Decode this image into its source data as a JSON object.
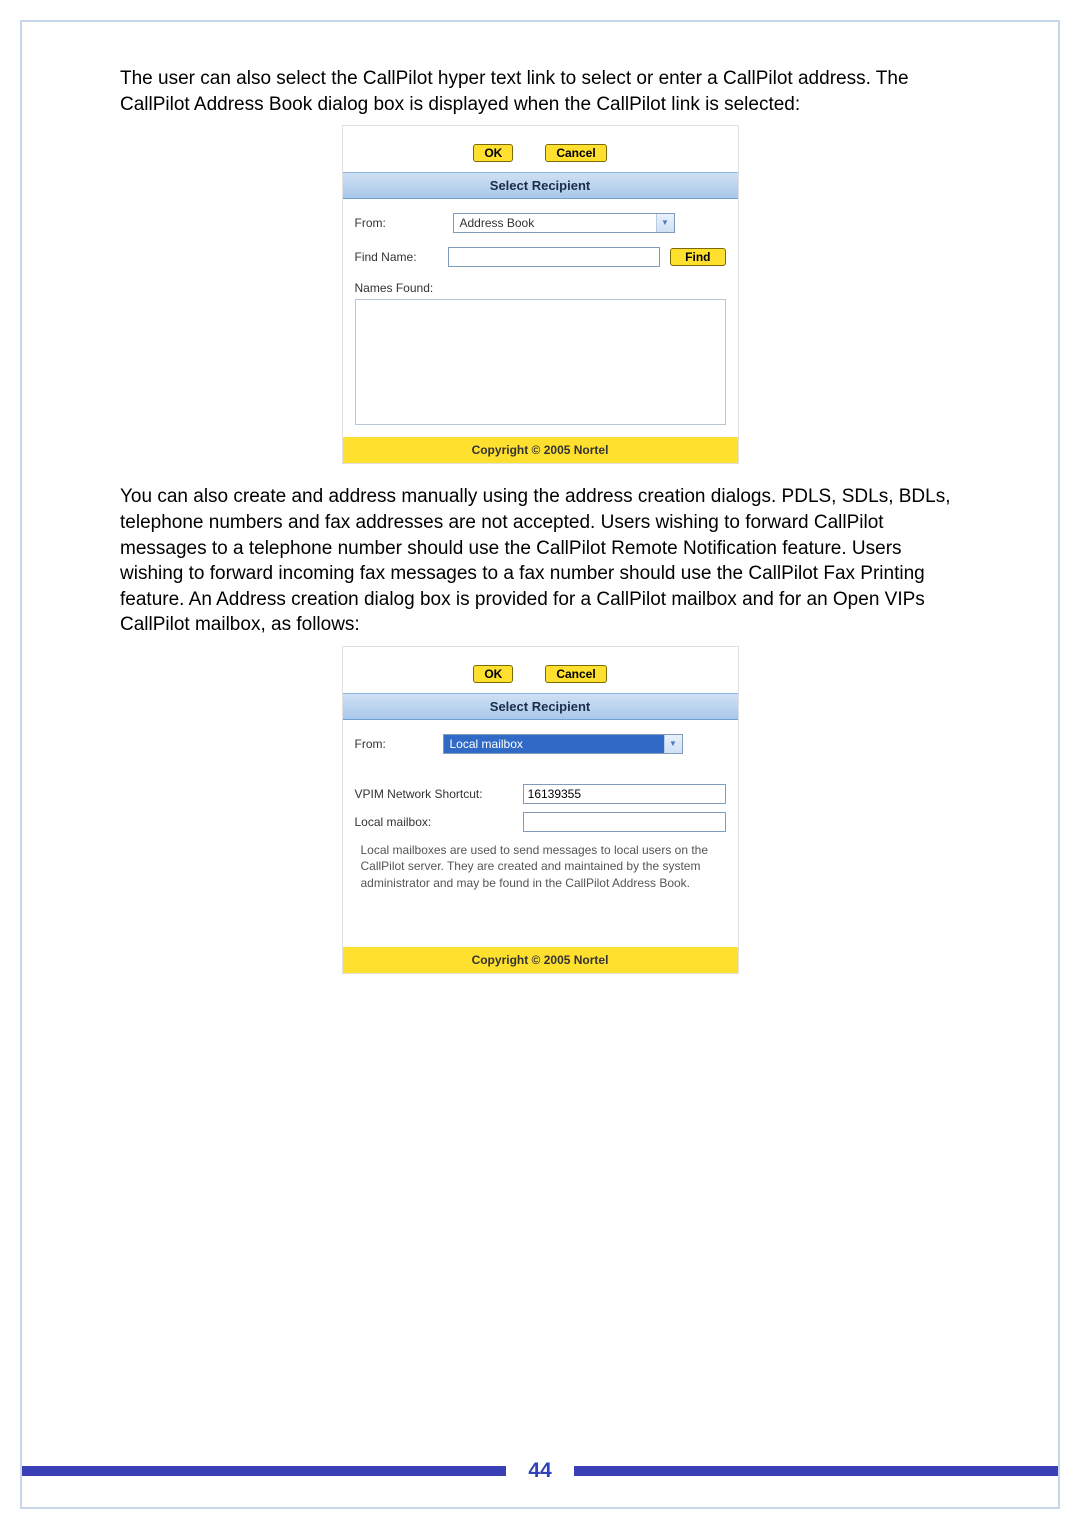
{
  "paragraph1": "The user can also select the CallPilot hyper text link to select or enter a CallPilot address. The CallPilot Address Book dialog box is displayed when the CallPilot link is selected:",
  "paragraph2": "You can also create and address manually using the address creation dialogs. PDLS, SDLs, BDLs, telephone numbers and fax addresses are not accepted.  Users wishing to forward CallPilot messages to a telephone number should use the CallPilot Remote Notification feature.  Users wishing to forward incoming fax messages to a fax number should use the CallPilot Fax Printing feature. An Address creation dialog box is provided for a CallPilot mailbox and for an Open VIPs CallPilot mailbox, as follows:",
  "dialog1": {
    "ok": "OK",
    "cancel": "Cancel",
    "title": "Select Recipient",
    "from_label": "From:",
    "from_value": "Address Book",
    "findname_label": "Find Name:",
    "findname_value": "",
    "find_btn": "Find",
    "namesfound_label": "Names Found:",
    "copyright": "Copyright © 2005 Nortel"
  },
  "dialog2": {
    "ok": "OK",
    "cancel": "Cancel",
    "title": "Select Recipient",
    "from_label": "From:",
    "from_value": "Local mailbox",
    "vpim_label": "VPIM Network Shortcut:",
    "vpim_value": "16139355",
    "localmbx_label": "Local mailbox:",
    "localmbx_value": "",
    "desc": "Local mailboxes are used to send messages to local users on the CallPilot server. They are created and maintained by the system administrator and may be found in the CallPilot Address Book.",
    "copyright": "Copyright © 2005 Nortel"
  },
  "page_number": "44"
}
